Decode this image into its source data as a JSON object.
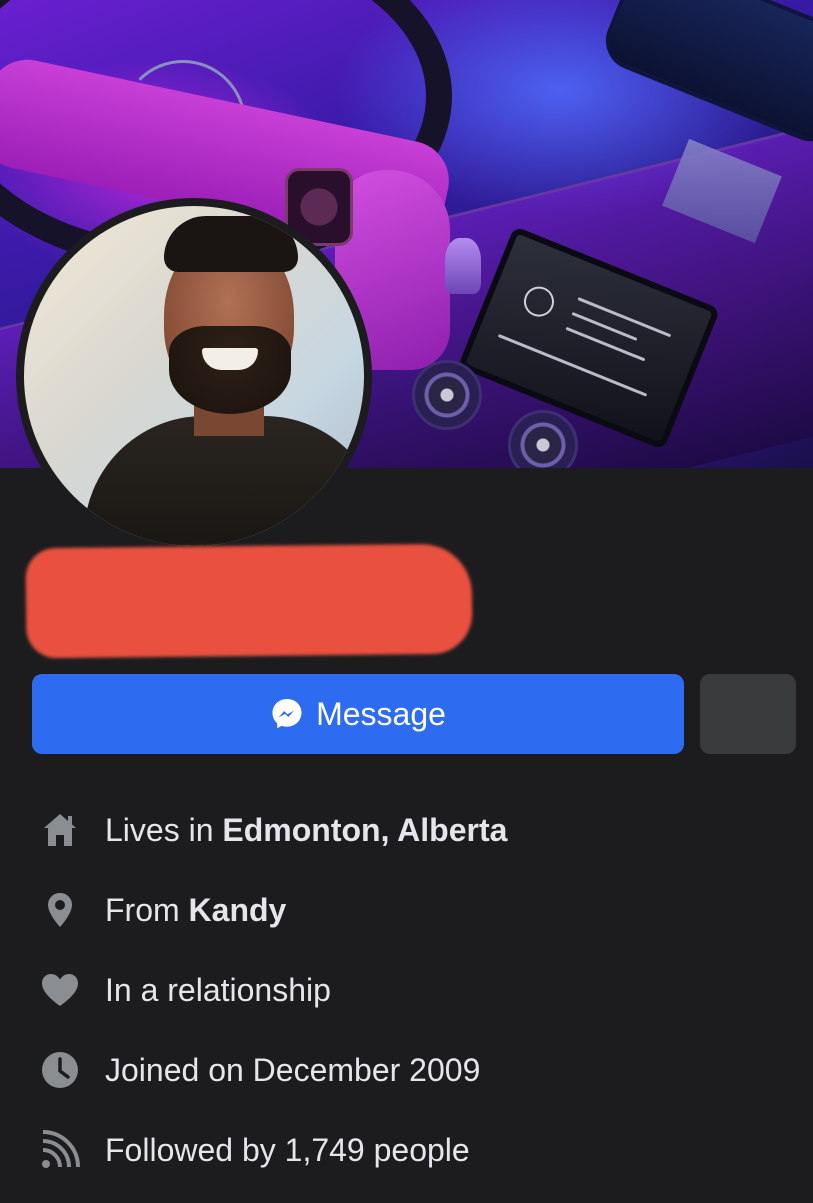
{
  "profile": {
    "name_redacted": true
  },
  "actions": {
    "message_label": "Message",
    "accent_color": "#2d6cf0"
  },
  "intro": [
    {
      "icon": "home-icon",
      "prefix": "Lives in ",
      "bold": "Edmonton, Alberta"
    },
    {
      "icon": "location-pin-icon",
      "prefix": "From ",
      "bold": "Kandy"
    },
    {
      "icon": "heart-icon",
      "prefix": "In a relationship",
      "bold": ""
    },
    {
      "icon": "clock-icon",
      "prefix": "Joined on December 2009",
      "bold": ""
    },
    {
      "icon": "followers-icon",
      "prefix": "Followed by 1,749 people",
      "bold": ""
    }
  ]
}
